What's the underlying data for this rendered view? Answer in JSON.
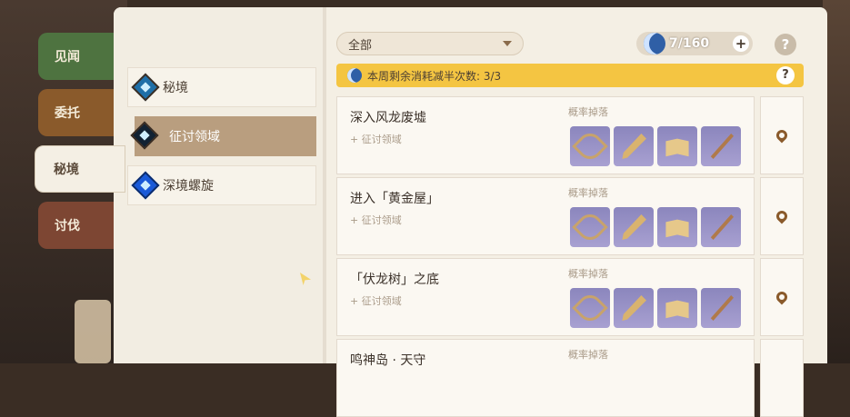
{
  "side_tabs": [
    {
      "label": "见闻",
      "active": false
    },
    {
      "label": "委托",
      "active": false
    },
    {
      "label": "秘境",
      "active": true
    },
    {
      "label": "讨伐",
      "active": false
    }
  ],
  "menu": {
    "items": [
      {
        "label": "秘境",
        "active": false
      },
      {
        "label": "征讨领域",
        "active": true
      },
      {
        "label": "深境螺旋",
        "active": false
      }
    ]
  },
  "filter": {
    "selected": "全部"
  },
  "resin": {
    "value": "7/160",
    "plus": "+"
  },
  "help_label": "?",
  "notice": {
    "text": "本周剩余消耗减半次数: 3/3",
    "help": "?"
  },
  "domains": [
    {
      "name": "深入风龙废墟",
      "type": "+ 征讨领域",
      "drops_label": "概率掉落"
    },
    {
      "name": "进入「黄金屋」",
      "type": "+ 征讨领域",
      "drops_label": "概率掉落"
    },
    {
      "name": "「伏龙树」之底",
      "type": "+ 征讨领域",
      "drops_label": "概率掉落"
    },
    {
      "name": "鸣神岛 · 天守",
      "type": "",
      "drops_label": "概率掉落"
    }
  ],
  "drop_icons": [
    "bow-icon",
    "sword-icon",
    "catalyst-book-icon",
    "polearm-icon"
  ],
  "colors": {
    "accent_yellow": "#f4c542",
    "active_menu": "#b99e7f",
    "paper": "#f4efe4"
  }
}
